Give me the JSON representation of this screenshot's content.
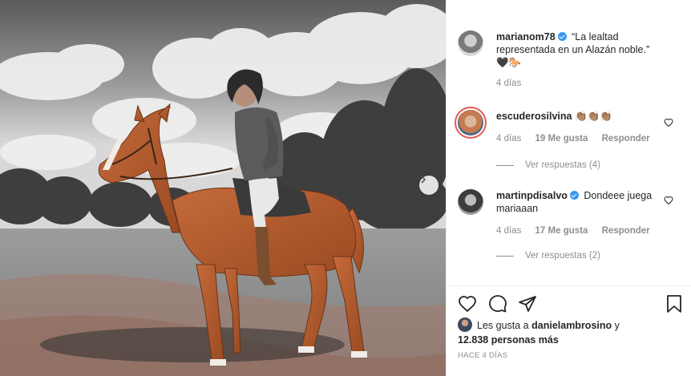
{
  "post": {
    "image_alt": "Hombre montado en un caballo alazán en un campo",
    "carousel_next_icon": "chevron-right-icon"
  },
  "caption": {
    "username": "marianom78",
    "verified": true,
    "text_line1": "“La lealtad",
    "text_line2": "representada en un Alazán noble.”",
    "emoji": "🖤🐎",
    "age": "4 días"
  },
  "comments": [
    {
      "username": "escuderosilvina",
      "text": "👏🏽👏🏽👏🏽",
      "age": "4 días",
      "likes": "19 Me gusta",
      "reply_label": "Responder",
      "view_replies": "Ver respuestas (4)"
    },
    {
      "username": "martinpdisalvo",
      "verified": true,
      "text_line1": "Dondeee juega",
      "text_line2": "mariaaan",
      "age": "4 días",
      "likes": "17 Me gusta",
      "reply_label": "Responder",
      "view_replies": "Ver respuestas (2)"
    }
  ],
  "likes": {
    "prefix": "Les gusta a",
    "user": "danielambrosino",
    "conj": "y",
    "count": "12.838 personas más"
  },
  "timestamp": "HACE 4 DÍAS",
  "colors": {
    "link": "#262626",
    "muted": "#8e8e8e",
    "verified": "#3897f0"
  }
}
